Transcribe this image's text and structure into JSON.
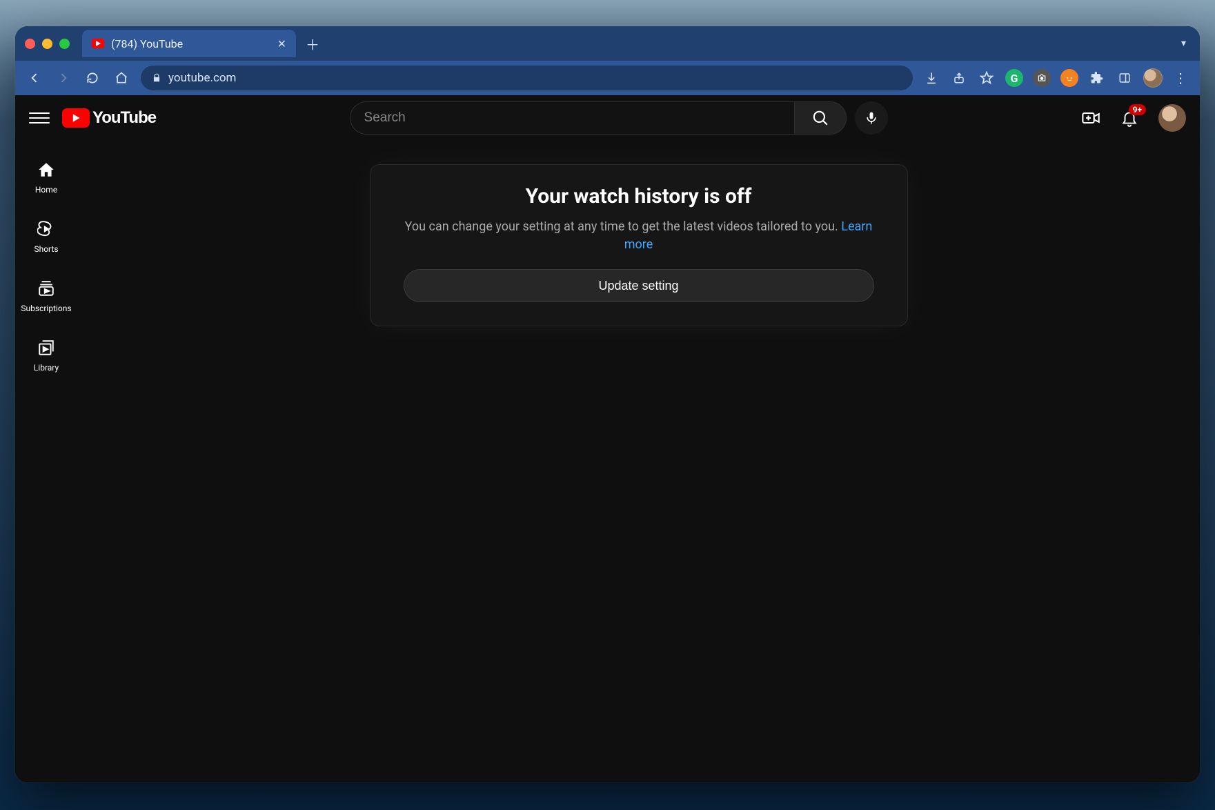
{
  "browser": {
    "tab": {
      "title": "(784) YouTube"
    },
    "url": "youtube.com"
  },
  "yt": {
    "logo_text": "YouTube",
    "search_placeholder": "Search",
    "notification_badge": "9+",
    "sidebar": {
      "home": "Home",
      "shorts": "Shorts",
      "subs": "Subscriptions",
      "library": "Library"
    },
    "card": {
      "title": "Your watch history is off",
      "body": "You can change your setting at any time to get the latest videos tailored to you. ",
      "learn_more": "Learn more",
      "button": "Update setting"
    }
  }
}
